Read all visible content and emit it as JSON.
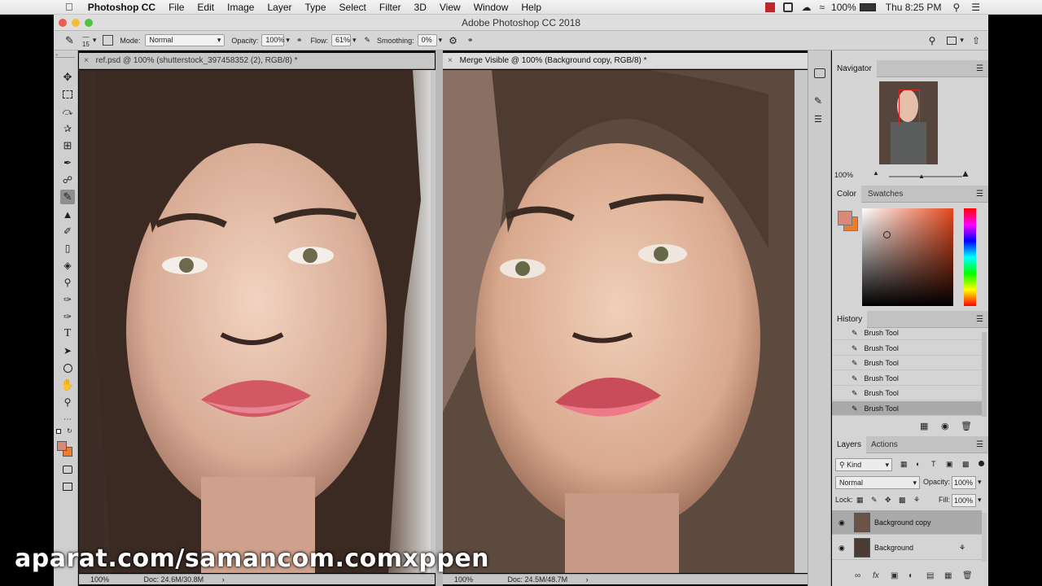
{
  "menubar": {
    "app": "Photoshop CC",
    "items": [
      "File",
      "Edit",
      "Image",
      "Layer",
      "Type",
      "Select",
      "Filter",
      "3D",
      "View",
      "Window",
      "Help"
    ],
    "battery": "100%",
    "clock": "Thu 8:25 PM"
  },
  "window": {
    "title": "Adobe Photoshop CC 2018"
  },
  "options": {
    "brush_size": "15",
    "mode_label": "Mode:",
    "mode_value": "Normal",
    "opacity_label": "Opacity:",
    "opacity_value": "100%",
    "flow_label": "Flow:",
    "flow_value": "61%",
    "smoothing_label": "Smoothing:",
    "smoothing_value": "0%"
  },
  "documents": [
    {
      "tab": "ref.psd @ 100% (shutterstock_397458352 (2), RGB/8) *",
      "zoom": "100%",
      "doc": "Doc: 24.6M/30.8M"
    },
    {
      "tab": "Merge Visible @ 100% (Background copy, RGB/8) *",
      "zoom": "100%",
      "doc": "Doc: 24.5M/48.7M"
    }
  ],
  "navigator": {
    "title": "Navigator",
    "zoom": "100%"
  },
  "color_panel": {
    "tabs": [
      "Color",
      "Swatches"
    ],
    "foreground": "#d9897a",
    "background": "#ee7c2a"
  },
  "history": {
    "title": "History",
    "items": [
      "Brush Tool",
      "Brush Tool",
      "Brush Tool",
      "Brush Tool",
      "Brush Tool",
      "Brush Tool"
    ]
  },
  "layers": {
    "tabs": [
      "Layers",
      "Actions"
    ],
    "kind": "Kind",
    "blend": "Normal",
    "opacity_label": "Opacity:",
    "opacity_value": "100%",
    "lock_label": "Lock:",
    "fill_label": "Fill:",
    "fill_value": "100%",
    "items": [
      {
        "name": "Background copy"
      },
      {
        "name": "Background"
      }
    ]
  },
  "watermark": "aparat.com/samancom.comxppen"
}
